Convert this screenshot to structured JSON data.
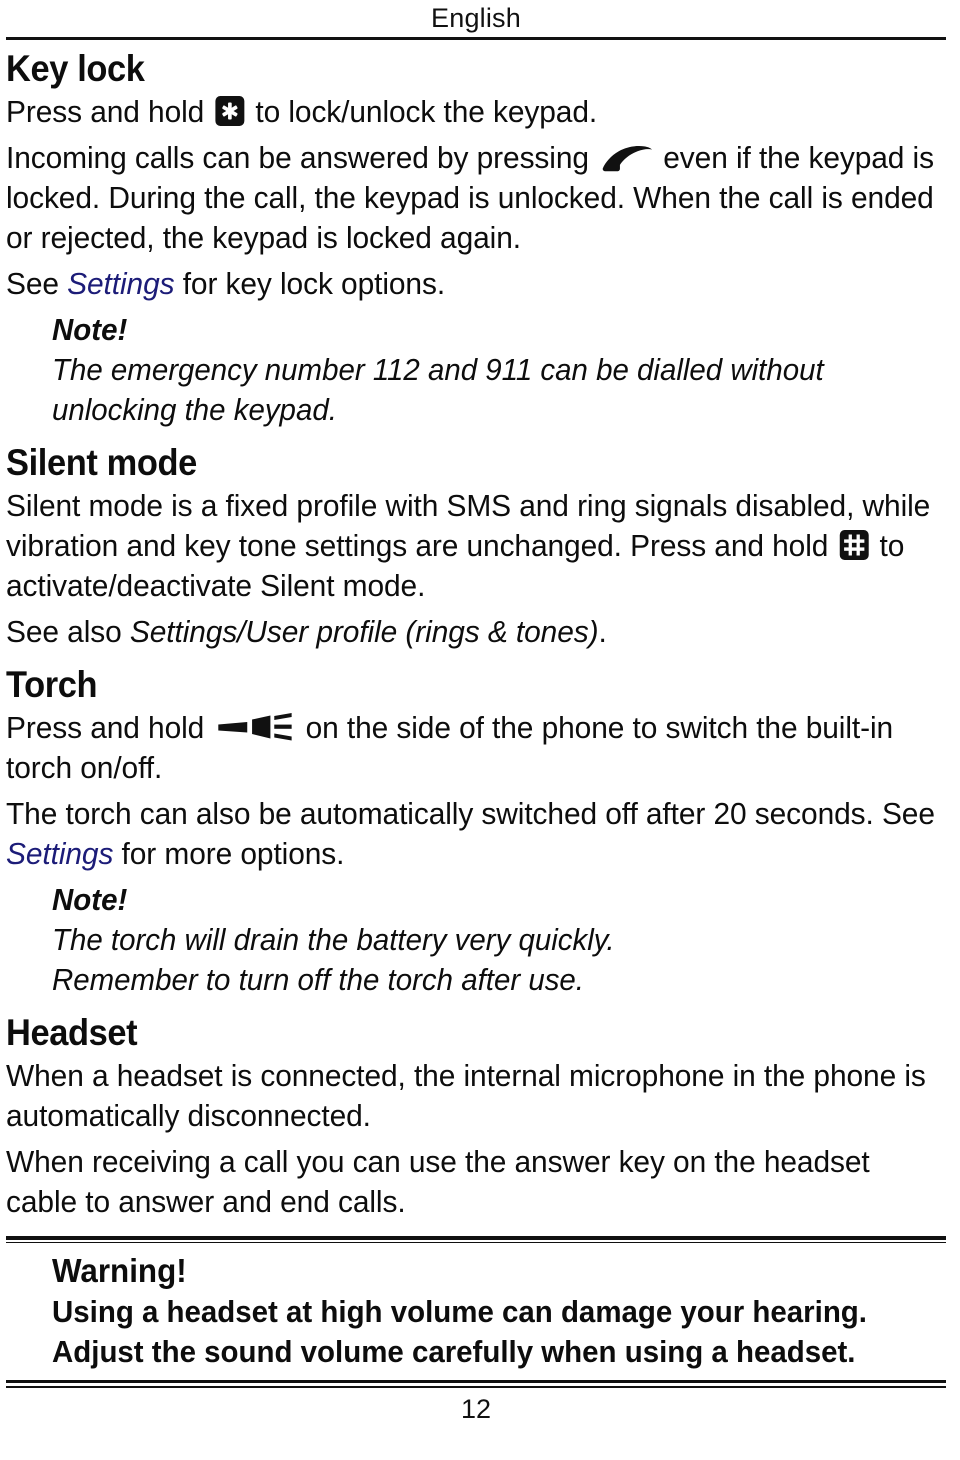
{
  "header": {
    "running_head": "English"
  },
  "sections": [
    {
      "id": "key-lock",
      "title": "Key lock",
      "paragraphs": [
        {
          "id": "keylock-p1",
          "pre": "Press and hold ",
          "icon": "star-key-icon",
          "post": " to lock/unlock the keypad."
        },
        {
          "id": "keylock-p2",
          "pre": "Incoming calls can be answered by pressing ",
          "icon": "phone-handset-icon",
          "post": " even if the keypad is locked. During the call, the keypad is unlocked. When the call is ended or rejected, the keypad is locked again."
        },
        {
          "id": "keylock-p3",
          "pre": "See ",
          "ref": "Settings",
          "post": " for key lock options."
        }
      ],
      "note": {
        "title": "Note!",
        "body": "The emergency number 112 and 911 can be dialled without unlocking the keypad."
      }
    },
    {
      "id": "silent-mode",
      "title": "Silent mode",
      "paragraphs": [
        {
          "id": "silent-p1",
          "pre": "Silent mode is a fixed profile with SMS and ring signals disabled, while vibration and key tone settings are unchanged. Press and hold ",
          "icon": "hash-key-icon",
          "post": " to activate/deactivate Silent mode."
        },
        {
          "id": "silent-p2",
          "pre": "See also ",
          "ref_black": "Settings/User profile (rings & tones)",
          "post": "."
        }
      ]
    },
    {
      "id": "torch",
      "title": "Torch",
      "paragraphs": [
        {
          "id": "torch-p1",
          "pre": "Press and hold ",
          "icon": "torch-side-key-icon",
          "post": " on the side of the phone to switch the built-in torch on/off."
        },
        {
          "id": "torch-p2",
          "pre": "The torch can also be automatically switched off after 20 seconds. See ",
          "ref": "Settings",
          "post": " for more options."
        }
      ],
      "note": {
        "title": "Note!",
        "body_line1": "The torch will drain the battery very quickly.",
        "body_line2": "Remember to turn off the torch after use."
      }
    },
    {
      "id": "headset",
      "title": "Headset",
      "paragraphs": [
        {
          "id": "headset-p1",
          "text": "When a headset is connected, the internal microphone in the phone is automatically disconnected."
        },
        {
          "id": "headset-p2",
          "text": "When receiving a call you can use the answer key on the headset cable to answer and end calls."
        }
      ]
    }
  ],
  "warning": {
    "title": "Warning!",
    "line1": "Using a headset at high volume can damage your hearing.",
    "line2": "Adjust the sound volume carefully when using a headset."
  },
  "footer": {
    "page_number": "12"
  },
  "colors": {
    "text": "#0d0d0d",
    "reference_link": "#1c1c78",
    "rule": "#111111",
    "keycap_background": "#111111",
    "keycap_glyph": "#ffffff"
  },
  "icons": {
    "star_key": "star-key-icon",
    "hash_key": "hash-key-icon",
    "phone_handset": "phone-handset-icon",
    "torch_side_key": "torch-side-key-icon"
  }
}
